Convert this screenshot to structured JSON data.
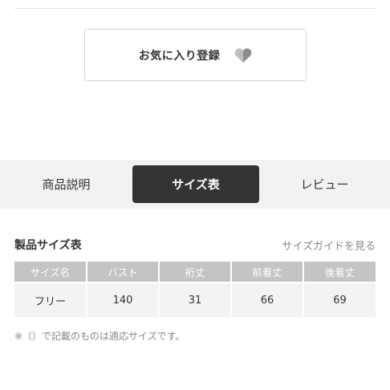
{
  "favorite": {
    "label": "お気に入り登録",
    "icon": "heart-icon"
  },
  "tabs": [
    {
      "label": "商品説明",
      "active": false
    },
    {
      "label": "サイズ表",
      "active": true
    },
    {
      "label": "レビュー",
      "active": false
    }
  ],
  "size_section": {
    "title": "製品サイズ表",
    "guide_link": "サイズガイドを見る",
    "headers": [
      "サイズ名",
      "バスト",
      "裄丈",
      "前着丈",
      "後着丈"
    ],
    "rows": [
      [
        "フリー",
        "140",
        "31",
        "66",
        "69"
      ]
    ],
    "note": "※（）で記載のものは適応サイズです。"
  },
  "colors": {
    "active_tab": "#333333",
    "tab_bar": "#f2f2f2",
    "table_header": "#c4c4c4",
    "table_cell": "#f3f3f3"
  }
}
